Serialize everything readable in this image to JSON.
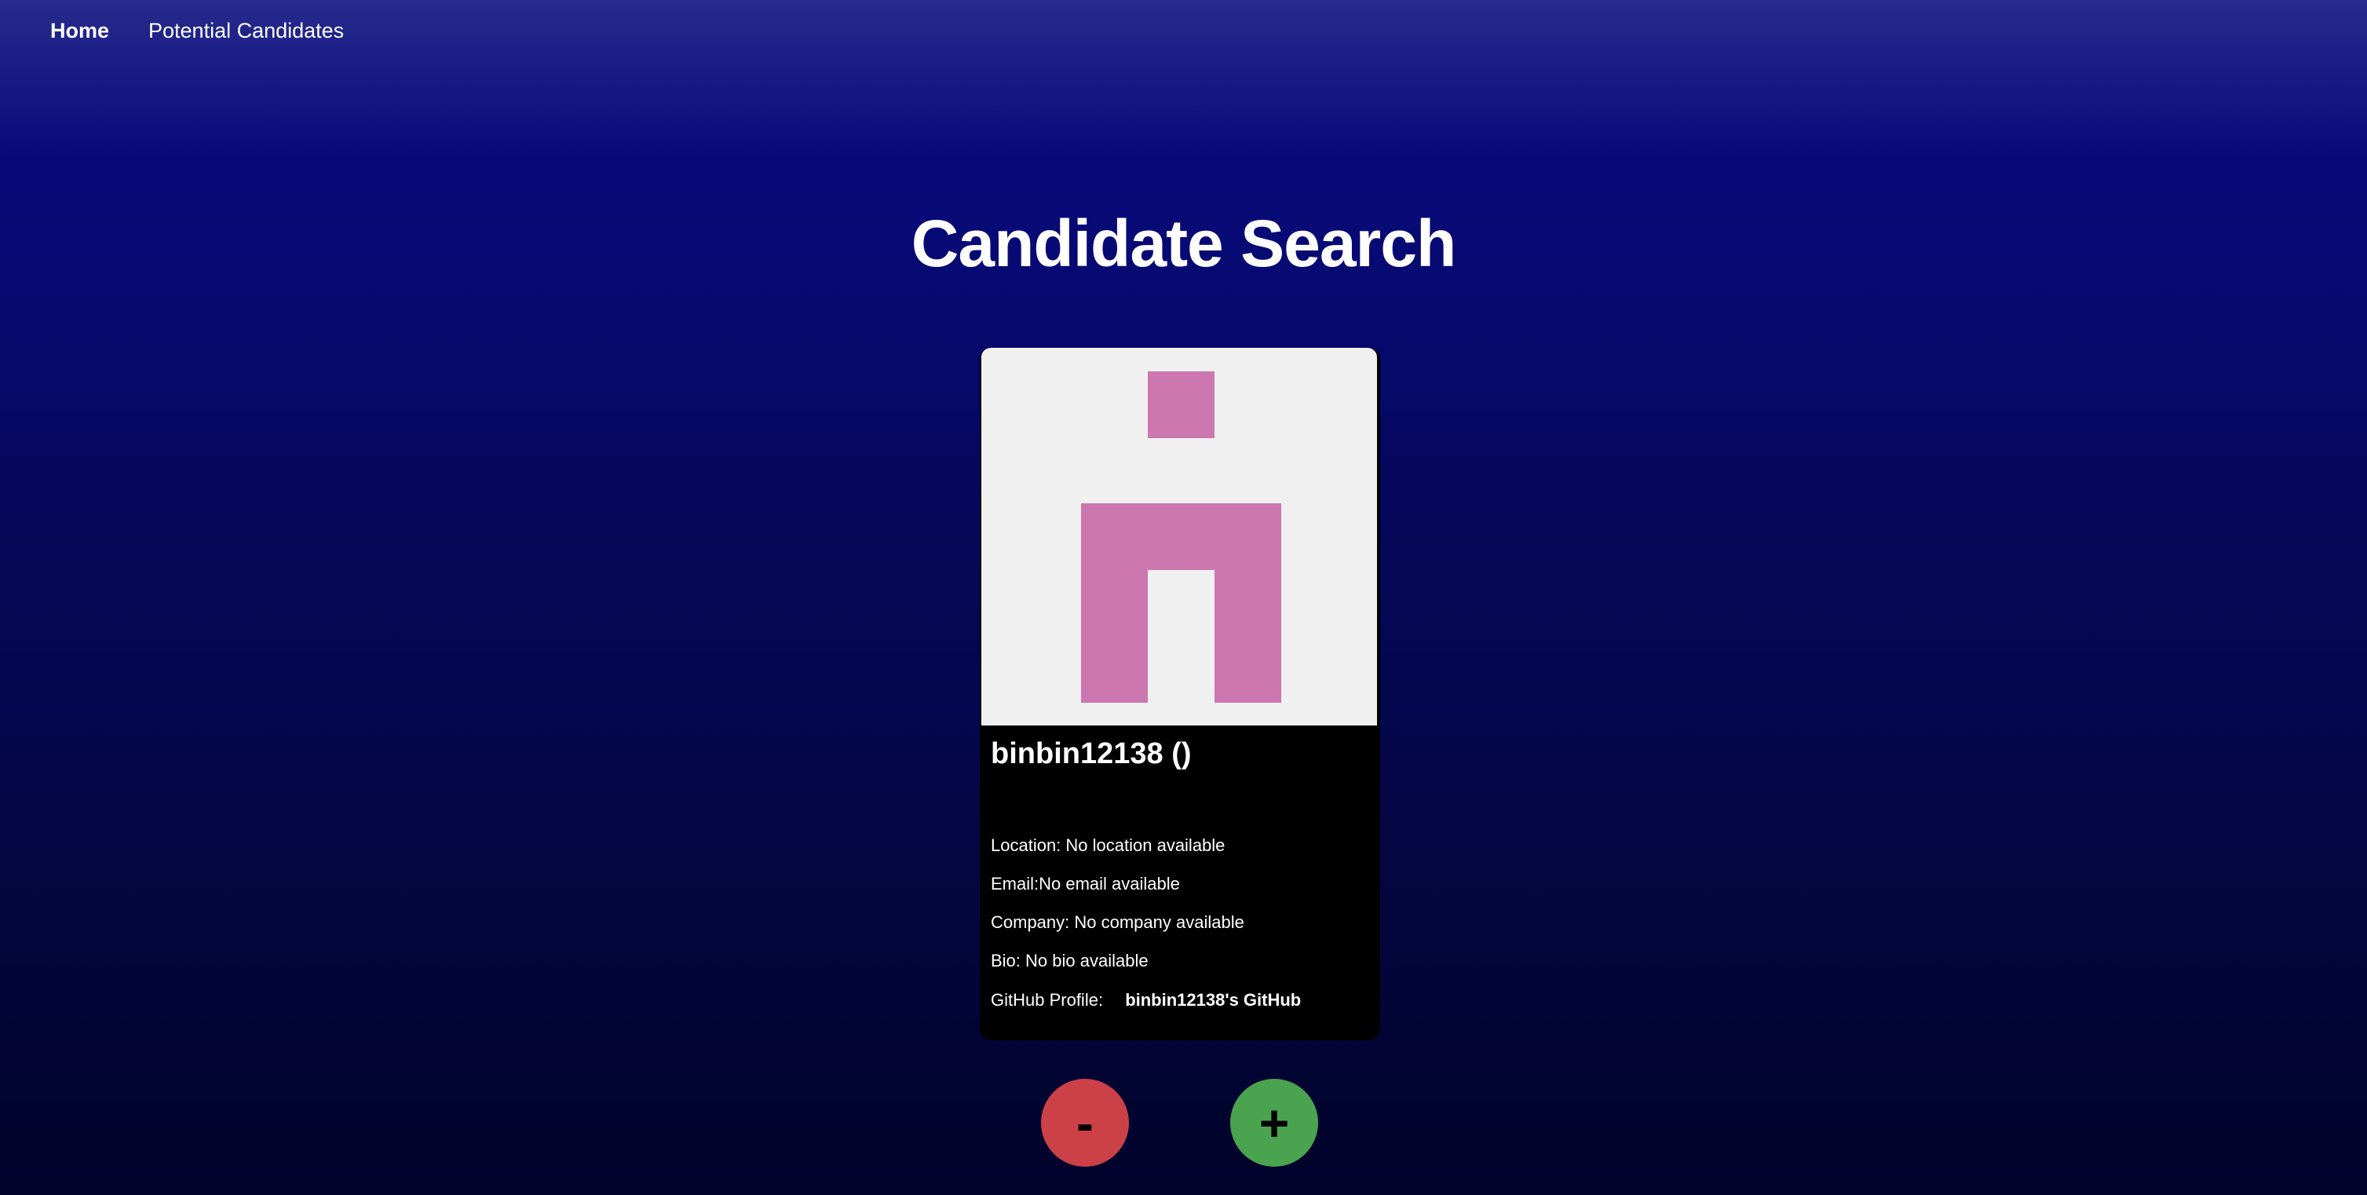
{
  "nav": {
    "home_label": "Home",
    "potential_label": "Potential Candidates"
  },
  "page": {
    "title": "Candidate Search"
  },
  "candidate": {
    "heading": "binbin12138 ()",
    "location": "Location: No location available",
    "email": "Email:No email available",
    "company": "Company: No company available",
    "bio": "Bio: No bio available",
    "github_prefix": "GitHub Profile:",
    "github_link_text": "binbin12138's GitHub",
    "avatar_color": "#cc77b0",
    "avatar_background": "#f0f0f0"
  },
  "actions": {
    "reject_label": "-",
    "accept_label": "+",
    "reject_color": "#cc4148",
    "accept_color": "#4aa34f"
  }
}
